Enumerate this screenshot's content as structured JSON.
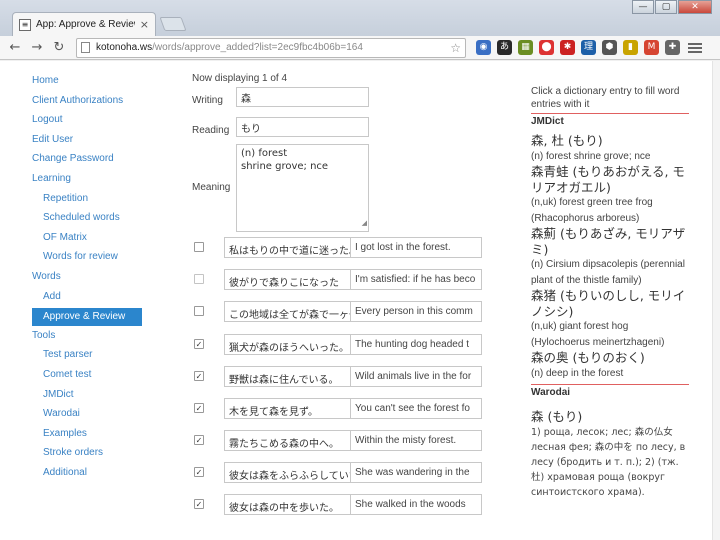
{
  "browser": {
    "tab_title": "App: Approve & Review",
    "tab_close": "×",
    "url_host": "kotonoha.ws",
    "url_path": "/words/approve_added?list=2ec9fbc4b06b=164",
    "window_controls": [
      "—",
      "▢",
      "✕"
    ],
    "extensions": [
      {
        "icon": "globe-icon",
        "glyph": "◉",
        "color": "#3a6fc4"
      },
      {
        "icon": "translate-icon",
        "glyph": "あ",
        "color": "#2a2a2a"
      },
      {
        "icon": "grid-icon",
        "glyph": "▦",
        "color": "#6b8e23"
      },
      {
        "icon": "stop-icon",
        "glyph": "⬤",
        "color": "#d33"
      },
      {
        "icon": "star-ext-icon",
        "glyph": "✱",
        "color": "#c22"
      },
      {
        "icon": "kanji-ext-icon",
        "glyph": "理",
        "color": "#1d5fa8"
      },
      {
        "icon": "shield-ext-icon",
        "glyph": "⬢",
        "color": "#555"
      },
      {
        "icon": "bookmark-ext-icon",
        "glyph": "▮",
        "color": "#c9a400"
      },
      {
        "icon": "mail-icon",
        "glyph": "M",
        "color": "#d64532"
      },
      {
        "icon": "plus-ext-icon",
        "glyph": "✚",
        "color": "#666"
      }
    ]
  },
  "nav": [
    {
      "name": "nav-home",
      "label": "Home",
      "sub": false,
      "active": false
    },
    {
      "name": "nav-client-authorizations",
      "label": "Client Authorizations",
      "sub": false,
      "active": false
    },
    {
      "name": "nav-logout",
      "label": "Logout",
      "sub": false,
      "active": false
    },
    {
      "name": "nav-edit-user",
      "label": "Edit User",
      "sub": false,
      "active": false
    },
    {
      "name": "nav-change-password",
      "label": "Change Password",
      "sub": false,
      "active": false
    },
    {
      "name": "nav-learning",
      "label": "Learning",
      "sub": false,
      "active": false
    },
    {
      "name": "nav-repetition",
      "label": "Repetition",
      "sub": true,
      "active": false
    },
    {
      "name": "nav-scheduled-words",
      "label": "Scheduled words",
      "sub": true,
      "active": false
    },
    {
      "name": "nav-of-matrix",
      "label": "OF Matrix",
      "sub": true,
      "active": false
    },
    {
      "name": "nav-words-for-review",
      "label": "Words for review",
      "sub": true,
      "active": false
    },
    {
      "name": "nav-words",
      "label": "Words",
      "sub": false,
      "active": false
    },
    {
      "name": "nav-add",
      "label": "Add",
      "sub": true,
      "active": false
    },
    {
      "name": "nav-approve-review",
      "label": "Approve & Review",
      "sub": true,
      "active": true
    },
    {
      "name": "nav-tools",
      "label": "Tools",
      "sub": false,
      "active": false
    },
    {
      "name": "nav-test-parser",
      "label": "Test parser",
      "sub": true,
      "active": false
    },
    {
      "name": "nav-comet-test",
      "label": "Comet test",
      "sub": true,
      "active": false
    },
    {
      "name": "nav-jmdict",
      "label": "JMDict",
      "sub": true,
      "active": false
    },
    {
      "name": "nav-warodai",
      "label": "Warodai",
      "sub": true,
      "active": false
    },
    {
      "name": "nav-examples",
      "label": "Examples",
      "sub": true,
      "active": false
    },
    {
      "name": "nav-stroke-orders",
      "label": "Stroke orders",
      "sub": true,
      "active": false
    },
    {
      "name": "nav-additional",
      "label": "Additional",
      "sub": true,
      "active": false
    }
  ],
  "form": {
    "displaying": "Now displaying 1 of 4",
    "writing_label": "Writing",
    "writing_value": "森",
    "reading_label": "Reading",
    "reading_value": "もり",
    "meaning_label": "Meaning",
    "meaning_value": "(n) forest\nshrine grove; nce"
  },
  "examples": [
    {
      "checked": false,
      "disabled": false,
      "jp": "私はもりの中で道に迷った。",
      "en": "I got lost in the forest."
    },
    {
      "checked": false,
      "disabled": true,
      "jp": "彼がりで森りこになった",
      "en": "I'm satisfied: if he has beco"
    },
    {
      "checked": false,
      "disabled": false,
      "jp": "この地域は全てが森で一ヶ一",
      "en": "Every person in this comm"
    },
    {
      "checked": true,
      "disabled": false,
      "jp": "猟犬が森のほうへいった。",
      "en": "The hunting dog headed t"
    },
    {
      "checked": true,
      "disabled": false,
      "jp": "野獣は森に住んでいる。",
      "en": "Wild animals live in the for"
    },
    {
      "checked": true,
      "disabled": false,
      "jp": "木を見て森を見ず。",
      "en": "You can't see the forest fo"
    },
    {
      "checked": true,
      "disabled": false,
      "jp": "霧たちこめる森の中へ。",
      "en": "Within the misty forest."
    },
    {
      "checked": true,
      "disabled": false,
      "jp": "彼女は森をふらふらしていた。",
      "en": "She was wandering in the"
    },
    {
      "checked": true,
      "disabled": false,
      "jp": "彼女は森の中を歩いた。",
      "en": "She walked in the woods"
    }
  ],
  "dictionary": {
    "hint": "Click a dictionary entry to fill word entries with it",
    "jmdict_head": "JMDict",
    "jmdict_entries": [
      {
        "word": "森, 杜 (もり)",
        "def": "(n) forest shrine grove; nce"
      },
      {
        "word": "森青蛙 (もりあおがえる, モリアオガエル)",
        "def": "(n,uk) forest green tree frog (Rhacophorus arboreus)"
      },
      {
        "word": "森薊 (もりあざみ, モリアザミ)",
        "def": "(n) Cirsium dipsacolepis (perennial plant of the thistle family)"
      },
      {
        "word": "森猪 (もりいのしし, モリイノシシ)",
        "def": "(n,uk) giant forest hog (Hylochoerus meinertzhageni)"
      },
      {
        "word": "森の奥 (もりのおく)",
        "def": "(n) deep in the forest"
      }
    ],
    "warodai_head": "Warodai",
    "warodai_word": "森 (もり)",
    "warodai_def": "1) роща, лесок; лес; 森の仏女 лесная фея; 森の中を по лесу, в лесу (бродить и т. п.); 2) (тж. 杜) храмовая роща (вокруг синтоистского храма)."
  }
}
